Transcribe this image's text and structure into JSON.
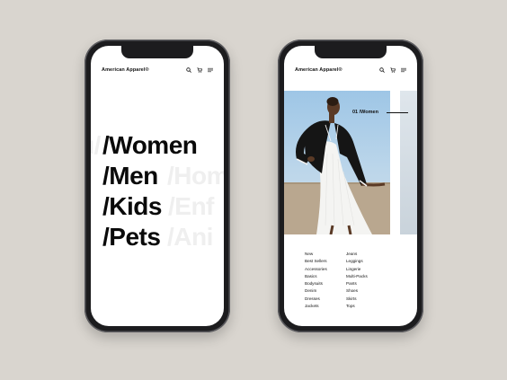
{
  "colors": {
    "background": "#d9d5cf",
    "phone_frame": "#1c1c1e",
    "screen": "#ffffff",
    "text": "#0a0a0a",
    "ghost_text": "#efefef"
  },
  "left_screen": {
    "brand": "American Apparel®",
    "icons": [
      "search-icon",
      "cart-icon",
      "menu-icon"
    ],
    "categories": [
      {
        "label": "/Women",
        "ghost_left": "u/",
        "ghost_right": ""
      },
      {
        "label": "/Men",
        "ghost_left": "",
        "ghost_right": "/Hom"
      },
      {
        "label": "/Kids",
        "ghost_left": "",
        "ghost_right": "/Enf"
      },
      {
        "label": "/Pets",
        "ghost_left": "",
        "ghost_right": "/Ani"
      }
    ]
  },
  "right_screen": {
    "brand": "American Apparel®",
    "icons": [
      "search-icon",
      "cart-icon",
      "menu-icon"
    ],
    "hero_label": "01 /Women",
    "menu_col_1": [
      "New",
      "Best Sellers",
      "Accessories",
      "Basics",
      "Bodysuits",
      "Denim",
      "Dresses",
      "Jackets"
    ],
    "menu_col_2": [
      "Jeans",
      "Leggings",
      "Lingerie",
      "Multi-Packs",
      "Pants",
      "Shoes",
      "Skirts",
      "Tops"
    ]
  }
}
